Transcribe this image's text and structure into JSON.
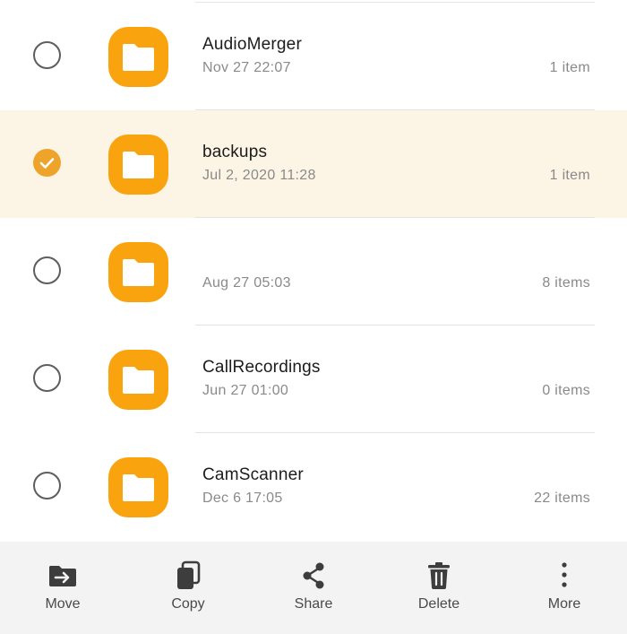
{
  "files": [
    {
      "name": "AudioMerger",
      "date": "Nov 27 22:07",
      "count": "1 item",
      "selected": false
    },
    {
      "name": "backups",
      "date": "Jul 2, 2020 11:28",
      "count": "1 item",
      "selected": true
    },
    {
      "name": "",
      "date": "Aug 27 05:03",
      "count": "8 items",
      "selected": false
    },
    {
      "name": "CallRecordings",
      "date": "Jun 27 01:00",
      "count": "0 items",
      "selected": false
    },
    {
      "name": "CamScanner",
      "date": "Dec 6 17:05",
      "count": "22 items",
      "selected": false
    }
  ],
  "actions": [
    {
      "label": "Move",
      "icon": "move-icon"
    },
    {
      "label": "Copy",
      "icon": "copy-icon"
    },
    {
      "label": "Share",
      "icon": "share-icon"
    },
    {
      "label": "Delete",
      "icon": "delete-icon"
    },
    {
      "label": "More",
      "icon": "more-icon"
    }
  ],
  "colors": {
    "accent": "#f9a40e",
    "check": "#eea32a",
    "selected_row": "#fcf4e4",
    "action_bar": "#f3f3f3"
  }
}
